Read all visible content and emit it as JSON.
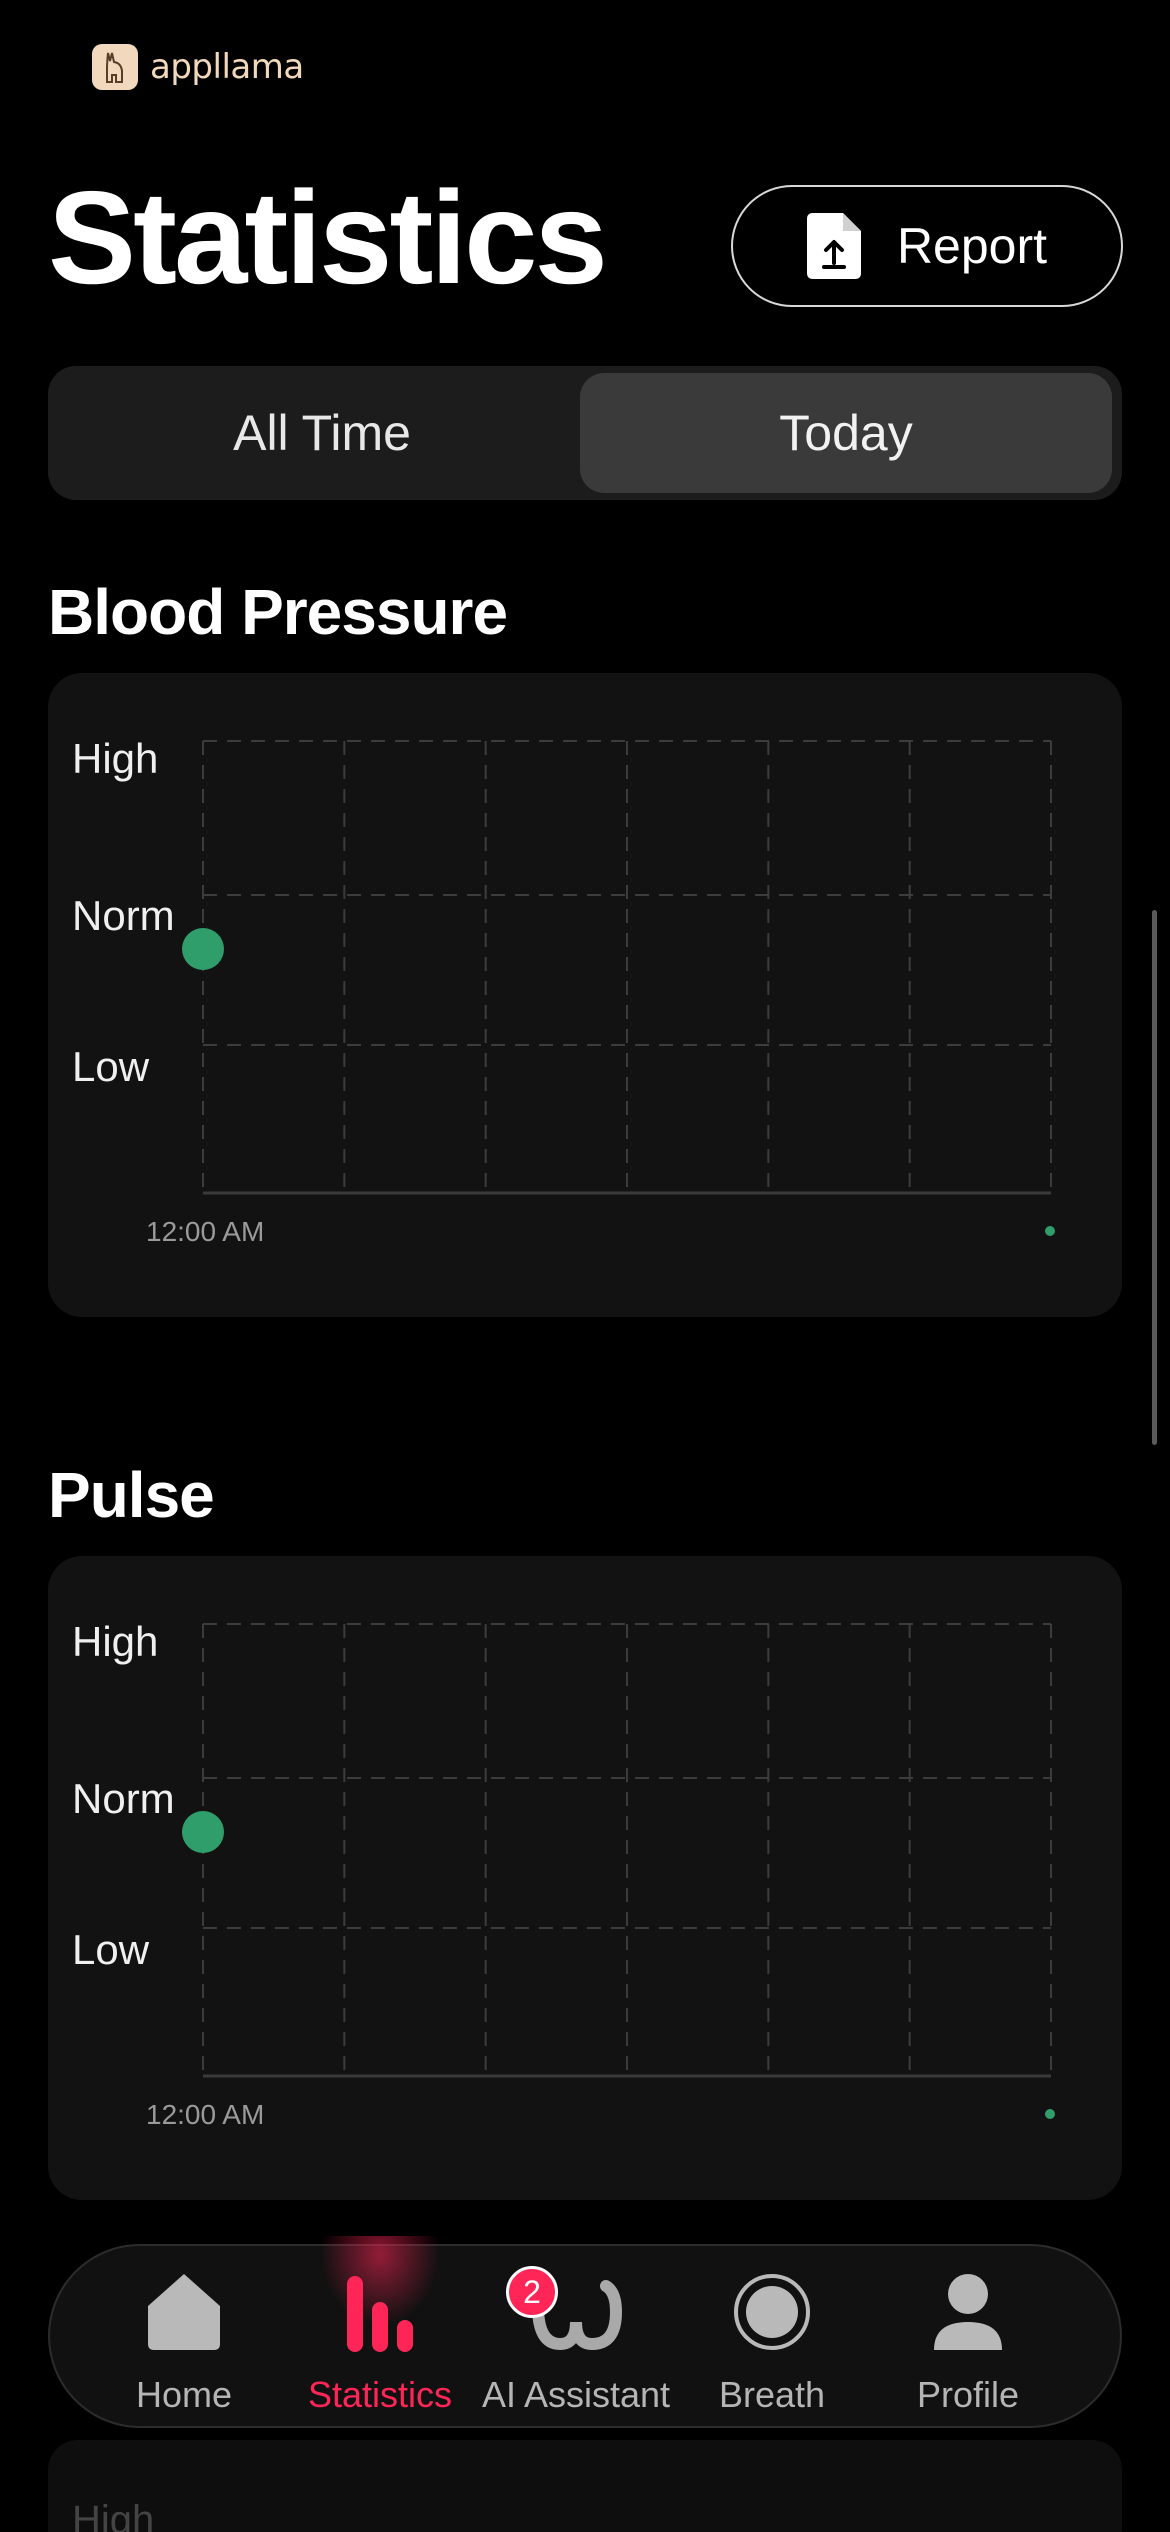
{
  "brand": {
    "name": "appllama"
  },
  "header": {
    "title": "Statistics",
    "report_label": "Report"
  },
  "segment": {
    "options": [
      "All Time",
      "Today"
    ],
    "selected": "Today"
  },
  "sections": [
    {
      "title": "Blood Pressure",
      "y_levels": [
        "High",
        "Norm",
        "Low"
      ],
      "x_start_label": "12:00 AM"
    },
    {
      "title": "Pulse",
      "y_levels": [
        "High",
        "Norm",
        "Low"
      ],
      "x_start_label": "12:00 AM"
    }
  ],
  "next_section_peek": "High",
  "tabbar": {
    "items": [
      {
        "label": "Home",
        "icon": "home-icon"
      },
      {
        "label": "Statistics",
        "icon": "statistics-icon"
      },
      {
        "label": "AI Assistant",
        "icon": "ai-assistant-icon",
        "badge": "2"
      },
      {
        "label": "Breath",
        "icon": "breath-icon"
      },
      {
        "label": "Profile",
        "icon": "profile-icon"
      }
    ],
    "active": "Statistics"
  },
  "colors": {
    "accent": "#ff2657",
    "point": "#2f9e6a",
    "card": "#121212",
    "segment_active": "#3a3a3a"
  },
  "chart_data": [
    {
      "type": "scatter",
      "title": "Blood Pressure",
      "y_categories": [
        "Low",
        "Norm",
        "High"
      ],
      "x_labels": [
        "12:00 AM"
      ],
      "points": [
        {
          "x": "12:00 AM",
          "y": "Norm"
        }
      ],
      "grid": true
    },
    {
      "type": "scatter",
      "title": "Pulse",
      "y_categories": [
        "Low",
        "Norm",
        "High"
      ],
      "x_labels": [
        "12:00 AM"
      ],
      "points": [
        {
          "x": "12:00 AM",
          "y": "Norm"
        }
      ],
      "grid": true
    }
  ]
}
